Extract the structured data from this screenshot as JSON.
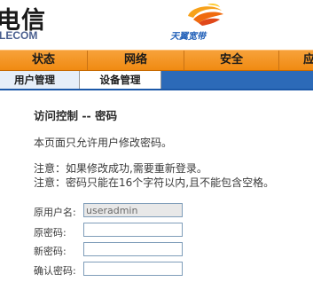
{
  "header": {
    "brand_cn": "电信",
    "brand_en": "LECOM",
    "logo_text": "天翼宽带",
    "accent_orange": "#f08a12",
    "accent_blue": "#1b58a8"
  },
  "main_nav": {
    "items": [
      {
        "label": "状态"
      },
      {
        "label": "网络"
      },
      {
        "label": "安全"
      },
      {
        "label": "应"
      }
    ]
  },
  "sub_nav": {
    "items": [
      {
        "label": "用户管理",
        "active": true
      },
      {
        "label": "设备管理",
        "active": false
      }
    ]
  },
  "page": {
    "title": "访问控制 -- 密码",
    "description": "本页面只允许用户修改密码。",
    "note1": "注意：如果修改成功,需要重新登录。",
    "note2": "注意：密码只能在16个字符以内,且不能包含空格。"
  },
  "form": {
    "username_label": "原用户名:",
    "username_value": "useradmin",
    "old_password_label": "原密码:",
    "new_password_label": "新密码:",
    "confirm_password_label": "确认密码:"
  }
}
